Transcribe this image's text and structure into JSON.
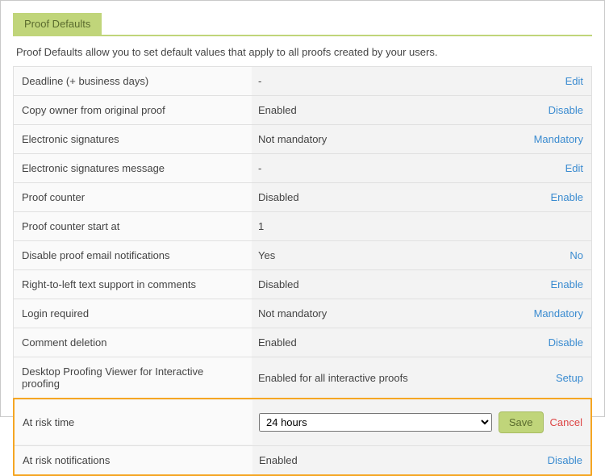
{
  "tab_label": "Proof Defaults",
  "intro": "Proof Defaults allow you to set default values that apply to all proofs created by your users.",
  "rows": [
    {
      "label": "Deadline (+ business days)",
      "value": "-",
      "action": "Edit"
    },
    {
      "label": "Copy owner from original proof",
      "value": "Enabled",
      "action": "Disable"
    },
    {
      "label": "Electronic signatures",
      "value": "Not mandatory",
      "action": "Mandatory"
    },
    {
      "label": "Electronic signatures message",
      "value": "-",
      "action": "Edit"
    },
    {
      "label": "Proof counter",
      "value": "Disabled",
      "action": "Enable"
    },
    {
      "label": "Proof counter start at",
      "value": "1",
      "action": ""
    },
    {
      "label": "Disable proof email notifications",
      "value": "Yes",
      "action": "No"
    },
    {
      "label": "Right-to-left text support in comments",
      "value": "Disabled",
      "action": "Enable"
    },
    {
      "label": "Login required",
      "value": "Not mandatory",
      "action": "Mandatory"
    },
    {
      "label": "Comment deletion",
      "value": "Enabled",
      "action": "Disable"
    },
    {
      "label": "Desktop Proofing Viewer for Interactive proofing",
      "value": "Enabled for all interactive proofs",
      "action": "Setup"
    }
  ],
  "at_risk_time": {
    "label": "At risk time",
    "selected": "24 hours",
    "save_label": "Save",
    "cancel_label": "Cancel"
  },
  "at_risk_notifications": {
    "label": "At risk notifications",
    "value": "Enabled",
    "action": "Disable"
  }
}
